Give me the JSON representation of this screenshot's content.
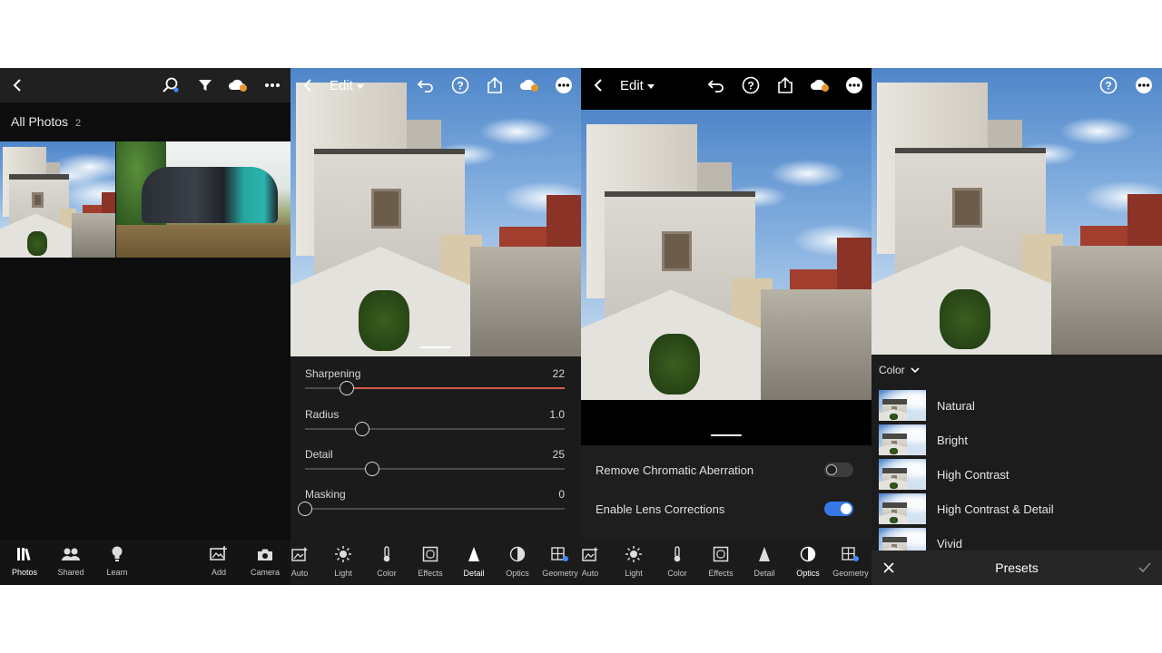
{
  "library": {
    "title": "All Photos",
    "count": "2",
    "tabs": [
      {
        "label": "Photos",
        "icon": "library-icon"
      },
      {
        "label": "Shared",
        "icon": "people-icon"
      },
      {
        "label": "Learn",
        "icon": "bulb-icon"
      },
      {
        "label": "Add",
        "icon": "add-photo-icon"
      },
      {
        "label": "Camera",
        "icon": "camera-icon"
      }
    ]
  },
  "edit": {
    "title": "Edit",
    "tools": [
      "Auto",
      "Light",
      "Color",
      "Effects",
      "Detail",
      "Optics",
      "Geometry"
    ]
  },
  "detail": {
    "sliders": [
      {
        "name": "Sharpening",
        "value": "22",
        "fraction": 0.16
      },
      {
        "name": "Radius",
        "value": "1.0",
        "fraction": 0.22
      },
      {
        "name": "Detail",
        "value": "25",
        "fraction": 0.26
      },
      {
        "name": "Masking",
        "value": "0",
        "fraction": 0.0
      }
    ],
    "accent": "#d9594c"
  },
  "optics": {
    "options": [
      {
        "name": "Remove Chromatic Aberration",
        "on": false
      },
      {
        "name": "Enable Lens Corrections",
        "on": true
      }
    ],
    "accent": "#3778e6"
  },
  "presets": {
    "category": "Color",
    "items": [
      "Natural",
      "Bright",
      "High Contrast",
      "High Contrast & Detail",
      "Vivid"
    ],
    "title": "Presets"
  }
}
